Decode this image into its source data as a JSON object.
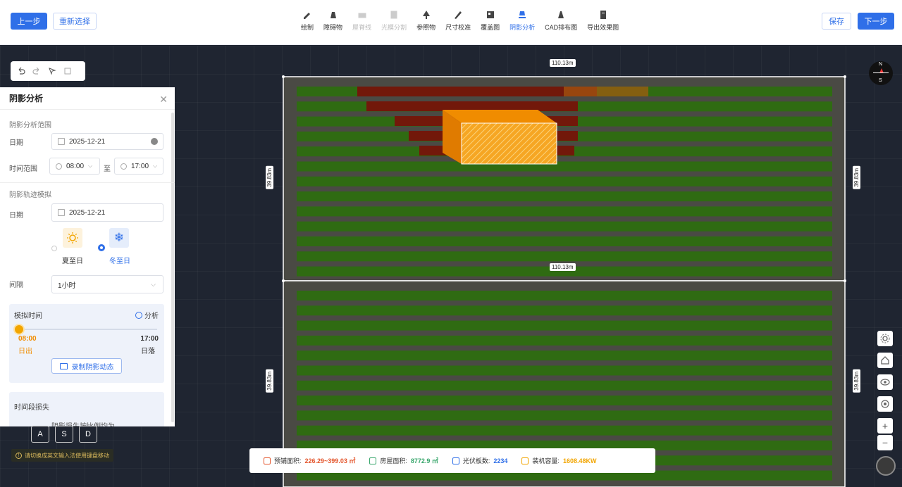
{
  "topbar": {
    "prev_label": "上一步",
    "reselect_label": "重新选择",
    "save_label": "保存",
    "next_label": "下一步",
    "tools": [
      {
        "label": "绘制",
        "icon": "pencil-icon",
        "state": "normal"
      },
      {
        "label": "障碍物",
        "icon": "obstacle-icon",
        "state": "normal"
      },
      {
        "label": "屋脊线",
        "icon": "ridge-icon",
        "state": "disabled"
      },
      {
        "label": "光模分割",
        "icon": "split-icon",
        "state": "disabled"
      },
      {
        "label": "参照物",
        "icon": "tree-icon",
        "state": "normal"
      },
      {
        "label": "尺寸校准",
        "icon": "ruler-icon",
        "state": "normal"
      },
      {
        "label": "覆盖图",
        "icon": "overlay-icon",
        "state": "normal"
      },
      {
        "label": "阴影分析",
        "icon": "shadow-icon",
        "state": "active"
      },
      {
        "label": "CAD排布图",
        "icon": "cad-icon",
        "state": "normal"
      },
      {
        "label": "导出效果图",
        "icon": "export-icon",
        "state": "normal"
      }
    ]
  },
  "panel": {
    "title": "阴影分析",
    "range_section": "阴影分析范围",
    "date_label": "日期",
    "date_value": "2025-12-21",
    "time_range_label": "时间范围",
    "time_start": "08:00",
    "time_sep": "至",
    "time_end": "17:00",
    "track_section": "阴影轨迹模拟",
    "track_date_label": "日期",
    "track_date_value": "2025-12-21",
    "summer_label": "夏至日",
    "winter_label": "冬至日",
    "interval_label": "间隔",
    "interval_value": "1小时",
    "sim_time_label": "模拟时间",
    "analyze_label": "分析",
    "sim_start_time": "08:00",
    "sim_start_label": "日出",
    "sim_end_time": "17:00",
    "sim_end_label": "日落",
    "sim_progress": 0,
    "record_label": "录制阴影动态",
    "loss_section": "时间段损失",
    "loss_text": "阴影损失按比例均为"
  },
  "keys": [
    "A",
    "S",
    "D"
  ],
  "hint": "请切换成英文输入法使用键盘移动",
  "dimensions": {
    "top_width": "110.13m",
    "mid_width": "110.13m",
    "left_height_1": "39.83m",
    "right_height_1": "39.83m",
    "left_height_2": "39.83m",
    "right_height_2": "39.83m"
  },
  "compass": {
    "north": "N",
    "south": "S"
  },
  "stats": {
    "lay_area_label": "预铺面积:",
    "lay_area_value": "226.29~399.03 ㎡",
    "roof_area_label": "房屋面积:",
    "roof_area_value": "8772.9 ㎡",
    "panel_count_label": "光伏板数:",
    "panel_count_value": "2234",
    "capacity_label": "装机容量:",
    "capacity_value": "1608.48KW"
  },
  "colors": {
    "primary": "#2f6fe8",
    "panel_green": "#2f6b12",
    "shadow_red": "#7a0f0a",
    "building_orange": "#f5a623",
    "roof_gray": "#4a4a44"
  }
}
